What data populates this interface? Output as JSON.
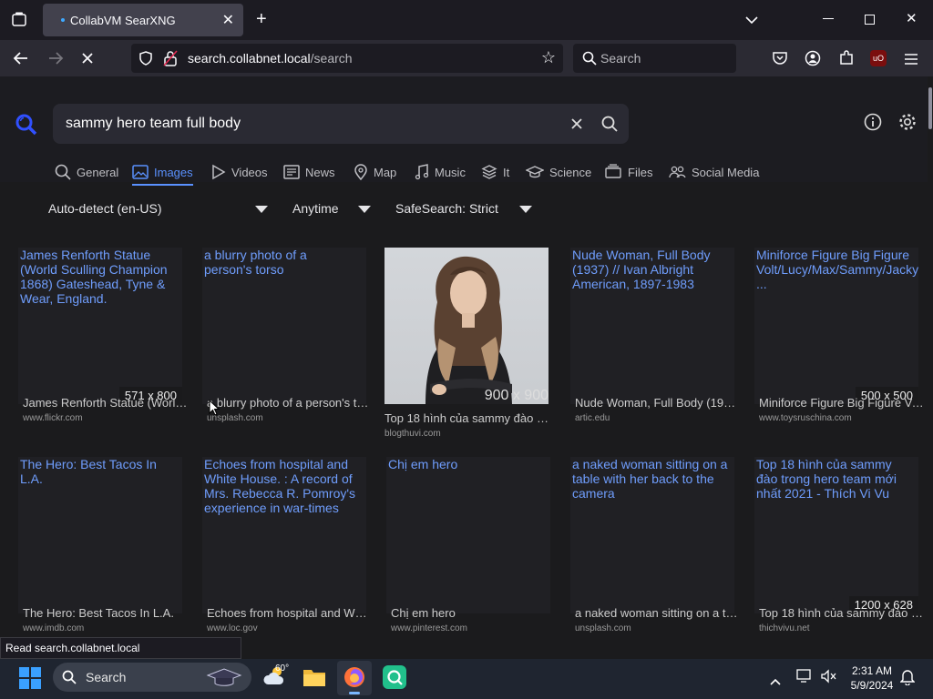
{
  "browser": {
    "tab_title": "CollabVM SearXNG",
    "url_host": "search.collabnet.local",
    "url_path": "/search",
    "search_placeholder": "Search"
  },
  "searx": {
    "query": "sammy hero team full body",
    "categories": [
      {
        "label": "General",
        "icon": "search-icon"
      },
      {
        "label": "Images",
        "icon": "image-icon"
      },
      {
        "label": "Videos",
        "icon": "play-icon"
      },
      {
        "label": "News",
        "icon": "newspaper-icon"
      },
      {
        "label": "Map",
        "icon": "map-pin-icon"
      },
      {
        "label": "Music",
        "icon": "music-icon"
      },
      {
        "label": "It",
        "icon": "layers-icon"
      },
      {
        "label": "Science",
        "icon": "graduation-cap-icon"
      },
      {
        "label": "Files",
        "icon": "file-stack-icon"
      },
      {
        "label": "Social Media",
        "icon": "people-icon"
      }
    ],
    "filters": {
      "language": "Auto-detect (en-US)",
      "time": "Anytime",
      "safesearch": "SafeSearch: Strict"
    },
    "results": [
      {
        "title": "James Renforth Statue (World Sculling Champion 1868) Gateshead, Tyne & Wear, England.",
        "resolution": "571 x 800",
        "caption": "James Renforth Statue (World Sculling Champion 1868) Gateshead",
        "domain": "www.flickr.com"
      },
      {
        "title": "a blurry photo of a person's torso",
        "resolution": "",
        "caption": "a blurry photo of a person's torso",
        "domain": "unsplash.com"
      },
      {
        "title": "",
        "resolution": "900 x 900",
        "caption": "Top 18 hình của sammy đào trong hero team",
        "domain": "blogthuvi.com"
      },
      {
        "title": "Nude Woman, Full Body (1937) // Ivan Albright American, 1897-1983",
        "resolution": "",
        "caption": "Nude Woman, Full Body (1937) // Ivan Albright",
        "domain": "artic.edu"
      },
      {
        "title": "Miniforce Figure Big Figure Volt/Lucy/Max/Sammy/Jacky ...",
        "resolution": "500 x 500",
        "caption": "Miniforce Figure Big Figure Volt/Lucy/Max",
        "domain": "www.toysruschina.com"
      },
      {
        "title": "The Hero: Best Tacos In L.A.",
        "resolution": "",
        "caption": "The Hero: Best Tacos In L.A.",
        "domain": "www.imdb.com"
      },
      {
        "title": "Echoes from hospital and White House. : A record of Mrs. Rebecca R. Pomroy's experience in war-times",
        "resolution": "",
        "caption": "Echoes from hospital and White House",
        "domain": "www.loc.gov"
      },
      {
        "title": "Chị em hero",
        "resolution": "",
        "caption": "Chị em hero",
        "domain": "www.pinterest.com"
      },
      {
        "title": "a naked woman sitting on a table with her back to the camera",
        "resolution": "",
        "caption": "a naked woman sitting on a table with her back",
        "domain": "unsplash.com"
      },
      {
        "title": "Top 18 hình của sammy đào trong hero team mới nhất 2021 - Thích Vi Vu",
        "resolution": "1200 x 628",
        "caption": "Top 18 hình của sammy đào trong hero team",
        "domain": "thichvivu.net"
      }
    ]
  },
  "status_text": "Read search.collabnet.local",
  "taskbar": {
    "search_label": "Search",
    "weather_temp": "60°",
    "time": "2:31 AM",
    "date": "5/9/2024"
  }
}
